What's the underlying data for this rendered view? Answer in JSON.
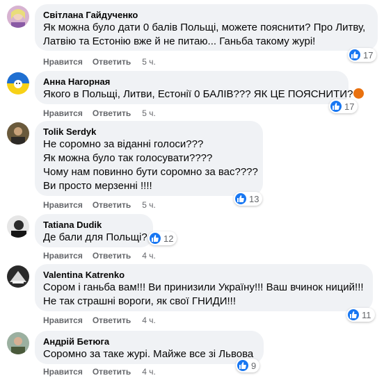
{
  "comments": [
    {
      "author": "Світлана Гайдученко",
      "lines": [
        "Як можна було дати 0 балів Польщі, можете пояснити? Про Литву,",
        "Латвію та Естонію вже й не питаю... Ганьба такому журі!"
      ],
      "like_label": "Нравится",
      "reply_label": "Ответить",
      "time": "5 ч.",
      "reactions": "17",
      "reaction_icon": "like-icon"
    },
    {
      "author": "Анна Нагорная",
      "lines": [
        "Якого в Польщі, Литви, Естонії 0 БАЛІВ??? ЯК ЦЕ ПОЯСНИТИ?"
      ],
      "emoji": "angry-face-emoji",
      "like_label": "Нравится",
      "reply_label": "Ответить",
      "time": "5 ч.",
      "reactions": "17",
      "reaction_icon": "like-icon"
    },
    {
      "author": "Tolik Serdyk",
      "lines": [
        "Не соромно за віданні голоси???",
        "Як можна було так голосувати????",
        "Чому нам повинно бути соромно за вас????",
        "Ви просто мерзенні !!!!"
      ],
      "like_label": "Нравится",
      "reply_label": "Ответить",
      "time": "5 ч.",
      "reactions": "13",
      "reaction_icon": "like-icon"
    },
    {
      "author": "Tatiana Dudik",
      "lines": [
        "Де бали для Польщі?"
      ],
      "like_label": "Нравится",
      "reply_label": "Ответить",
      "time": "4 ч.",
      "reactions": "12",
      "reaction_icon": "like-icon"
    },
    {
      "author": "Valentina Katrenko",
      "lines": [
        "Сором і ганьба вам!!! Ви принизили Україну!!! Ваш вчинок ниций!!!",
        "Не так страшні вороги, як свої ГНИДИ!!!"
      ],
      "like_label": "Нравится",
      "reply_label": "Ответить",
      "time": "4 ч.",
      "reactions": "11",
      "reaction_icon": "like-icon"
    },
    {
      "author": "Андрій Бетюга",
      "lines": [
        "Соромно за таке журі. Майже все зі Львова"
      ],
      "like_label": "Нравится",
      "reply_label": "Ответить",
      "time": "4 ч.",
      "reactions": "9",
      "reaction_icon": "like-icon"
    }
  ],
  "colors": {
    "bubble": "#f0f2f5",
    "like_blue": "#1877f2",
    "meta_gray": "#65676b"
  }
}
